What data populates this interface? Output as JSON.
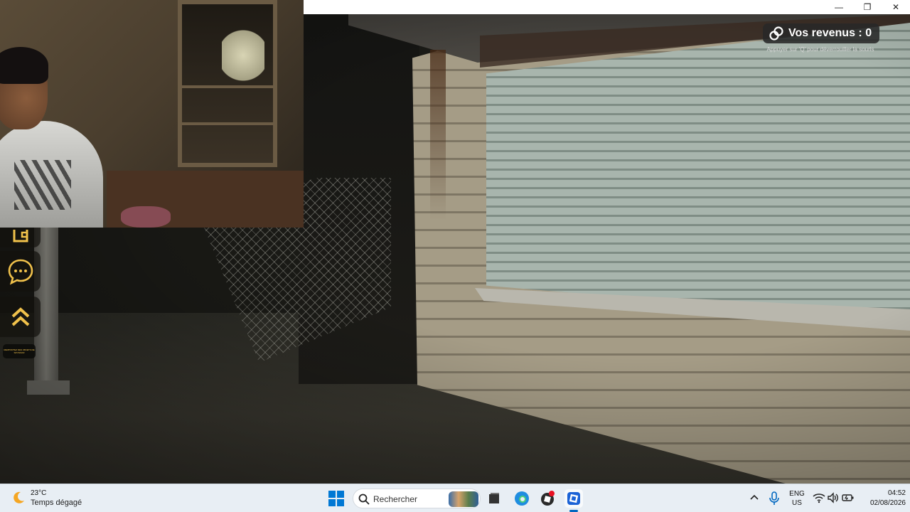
{
  "game": {
    "earnings_label": "Vos revenus : 0",
    "unlock_hint": "Appuyer sur 'Q' pour déverrouiller la souris",
    "side_small_text": "REMPORTEZ DES OBJETS DE SPONSOR",
    "side_buttons": [
      "wallet-icon",
      "chat-bubble-icon",
      "double-chevron-up-icon"
    ]
  },
  "window": {
    "minimize_glyph": "—",
    "restore_glyph": "❐",
    "close_glyph": "✕"
  },
  "taskbar": {
    "weather": {
      "temp": "23°C",
      "condition": "Temps dégagé"
    },
    "search_placeholder": "Rechercher",
    "language": {
      "line1": "ENG",
      "line2": "US"
    },
    "clock": {
      "time": "04:52",
      "date": "02/08/2026"
    },
    "accent": "#0067c0"
  },
  "colors": {
    "hud_pill": "#282828",
    "gold_icons": "#f0c14b",
    "taskbar_bg": "#e8eef4"
  }
}
